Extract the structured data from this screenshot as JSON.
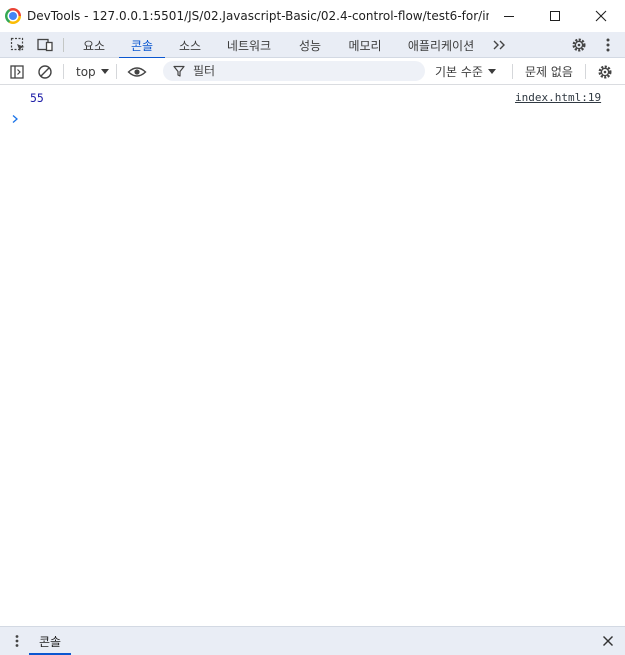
{
  "window": {
    "title": "DevTools - 127.0.0.1:5501/JS/02.Javascript-Basic/02.4-control-flow/test6-for/index.h..."
  },
  "tabs": [
    {
      "label": "요소"
    },
    {
      "label": "콘솔",
      "active": true
    },
    {
      "label": "소스"
    },
    {
      "label": "네트워크"
    },
    {
      "label": "성능"
    },
    {
      "label": "메모리"
    },
    {
      "label": "애플리케이션"
    }
  ],
  "toolbar": {
    "context": "top",
    "filter_placeholder": "필터",
    "levels": "기본 수준",
    "issues": "문제 없음"
  },
  "console": {
    "messages": [
      {
        "value": "55",
        "source": "index.html:19"
      }
    ]
  },
  "drawer": {
    "tab_label": "콘솔"
  },
  "colors": {
    "accent": "#0b57d0",
    "toolbar_bg": "#e9edf5",
    "value_text": "#1a1aa6"
  },
  "icons": [
    "chrome-logo",
    "minimize-icon",
    "maximize-icon",
    "close-icon",
    "inspect-element-icon",
    "device-toolbar-icon",
    "more-tabs-icon",
    "settings-icon",
    "more-options-icon",
    "sidebar-toggle-icon",
    "clear-console-icon",
    "eye-icon",
    "filter-icon",
    "prompt-chevron-icon"
  ]
}
